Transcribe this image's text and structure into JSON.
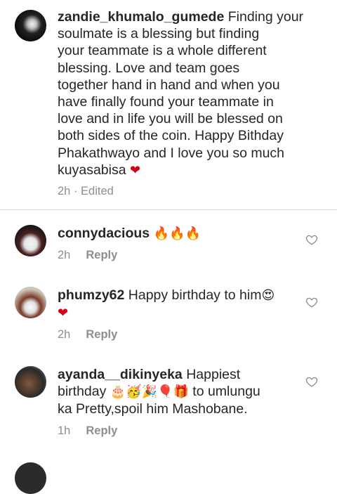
{
  "comments": [
    {
      "username": "zandie_khumalo_gumede",
      "lines": [
        " Finding your",
        "soulmate is a blessing but finding",
        "your teammate is a whole different",
        "blessing. Love and team goes",
        "together hand in hand and when you",
        "have finally found your teammate in",
        "love and in life you will be blessed on",
        "both sides of the coin. Happy Bithday",
        "Phakathwayo and I love you so much",
        "kuyasabisa "
      ],
      "emoji_end": "❤",
      "time": "2h",
      "edited": " · Edited"
    },
    {
      "username": "connydacious",
      "emojis": " 🔥🔥🔥",
      "time": "2h",
      "reply": "Reply"
    },
    {
      "username": "phumzy62",
      "text": " Happy birthday to him",
      "emoji1": "😍",
      "emoji2": "❤",
      "time": "2h",
      "reply": "Reply"
    },
    {
      "username": "ayanda__dikinyeka",
      "line1": " Happiest",
      "line2_start": "birthday ",
      "line2_emojis": "🎂🥳🎉🎈🎁",
      "line2_end": " to umlungu",
      "line3": "ka Pretty,spoil him Mashobane.",
      "time": "1h",
      "reply": "Reply"
    }
  ],
  "icons": {
    "like": "heart-outline-icon"
  },
  "colors": {
    "text": "#262626",
    "meta": "#8e8e8e",
    "heart_red": "#d0021b",
    "divider": "#dbdbdb"
  }
}
